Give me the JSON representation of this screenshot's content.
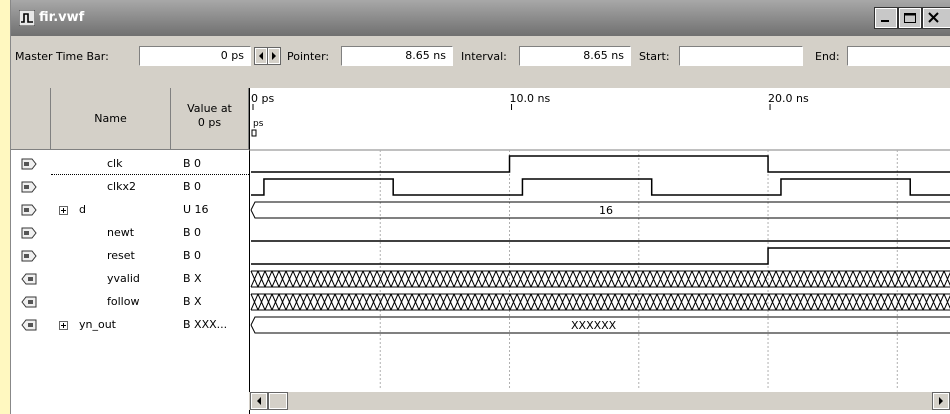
{
  "window": {
    "title": "fir.vwf",
    "colors": {
      "title_bar": "#8a8a8a",
      "background": "#d4d0c8",
      "page_bg": "#fff8c0"
    }
  },
  "toolbar": {
    "master_time_bar_label": "Master Time Bar:",
    "master_time_bar_value": "0 ps",
    "pointer_label": "Pointer:",
    "pointer_value": "8.65 ns",
    "interval_label": "Interval:",
    "interval_value": "8.65 ns",
    "start_label": "Start:",
    "start_value": "",
    "end_label": "End:",
    "end_value": ""
  },
  "columns": {
    "name": "Name",
    "value_line1": "Value at",
    "value_line2": "0 ps"
  },
  "timeline": {
    "tick_labels": [
      "0 ps",
      "10.0 ns",
      "20.0 ns"
    ],
    "marker_label": "ps",
    "total_ns": 27
  },
  "signals": [
    {
      "name": "clk",
      "value": "B 0",
      "icon": "input-pin-icon",
      "expandable": false,
      "type": "digital",
      "transitions": [
        [
          0,
          0
        ],
        [
          10,
          1
        ],
        [
          20,
          0
        ]
      ]
    },
    {
      "name": "clkx2",
      "value": "B 0",
      "icon": "input-pin-icon",
      "expandable": false,
      "type": "digital",
      "transitions": [
        [
          0,
          0
        ],
        [
          0.5,
          1
        ],
        [
          5.5,
          0
        ],
        [
          10.5,
          1
        ],
        [
          15.5,
          0
        ],
        [
          20.5,
          1
        ],
        [
          25.5,
          0
        ]
      ]
    },
    {
      "name": "d",
      "value": "U 16",
      "icon": "input-bus-icon",
      "expandable": true,
      "type": "bus",
      "bus_label": "16"
    },
    {
      "name": "newt",
      "value": "B 0",
      "icon": "input-pin-icon",
      "expandable": false,
      "type": "digital",
      "transitions": [
        [
          0,
          0
        ]
      ]
    },
    {
      "name": "reset",
      "value": "B 0",
      "icon": "input-pin-icon",
      "expandable": false,
      "type": "digital",
      "transitions": [
        [
          0,
          0
        ],
        [
          20,
          1
        ]
      ]
    },
    {
      "name": "yvalid",
      "value": "B X",
      "icon": "output-pin-icon",
      "expandable": false,
      "type": "unknown"
    },
    {
      "name": "follow",
      "value": "B X",
      "icon": "output-pin-icon",
      "expandable": false,
      "type": "unknown"
    },
    {
      "name": "yn_out",
      "value": "B XXX...",
      "icon": "output-bus-icon",
      "expandable": true,
      "type": "busx",
      "bus_label": "XXXXXX"
    }
  ]
}
